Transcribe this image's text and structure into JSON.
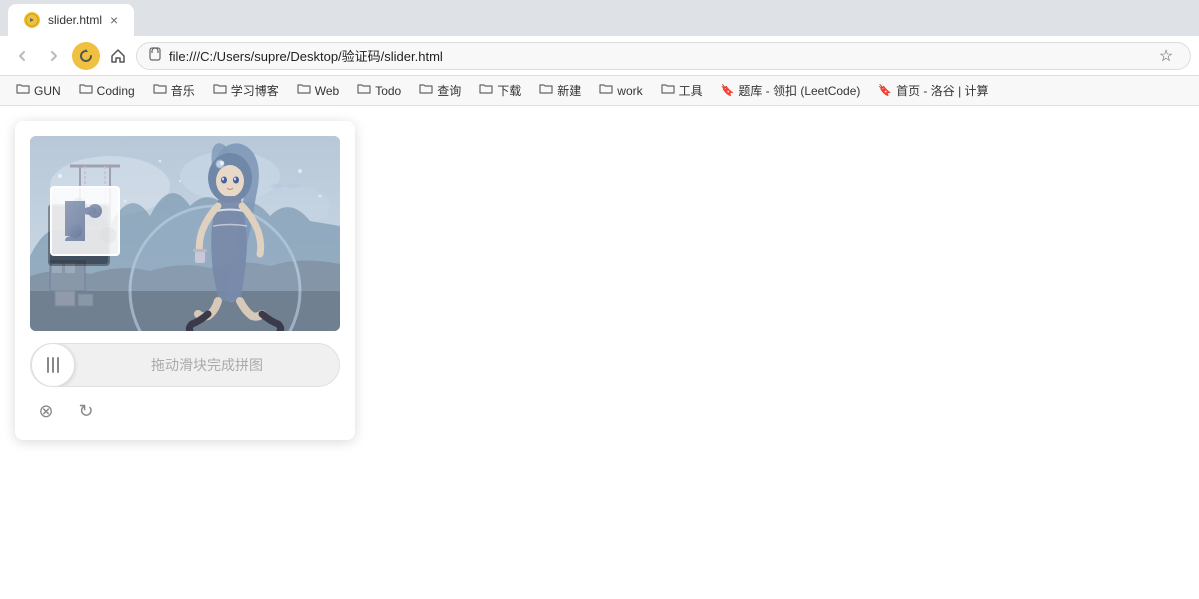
{
  "browser": {
    "tab": {
      "favicon_bg": "#f0c040",
      "title": "slider.html",
      "favicon_char": "◄"
    },
    "nav": {
      "back_disabled": true,
      "forward_disabled": true,
      "address": "file:///C:/Users/supre/Desktop/验证码/slider.html",
      "reload_char": "↺",
      "home_char": "⌂",
      "star_char": "☆"
    },
    "bookmarks": [
      {
        "label": "GUN",
        "icon": "📁"
      },
      {
        "label": "Coding",
        "icon": "📁"
      },
      {
        "label": "音乐",
        "icon": "📁"
      },
      {
        "label": "学习博客",
        "icon": "📁"
      },
      {
        "label": "Web",
        "icon": "📁"
      },
      {
        "label": "Todo",
        "icon": "📁"
      },
      {
        "label": "查询",
        "icon": "📁"
      },
      {
        "label": "下载",
        "icon": "📁"
      },
      {
        "label": "新建",
        "icon": "📁"
      },
      {
        "label": "work",
        "icon": "📁"
      },
      {
        "label": "工具",
        "icon": "📁"
      },
      {
        "label": "题库 - 领扣 (LeetCode)",
        "icon": "🔖"
      },
      {
        "label": "首页 - 洛谷 | 计算",
        "icon": "🔖"
      }
    ]
  },
  "captcha": {
    "slider_hint": "拖动滑块完成拼图",
    "close_icon": "⊗",
    "refresh_icon": "↻"
  }
}
